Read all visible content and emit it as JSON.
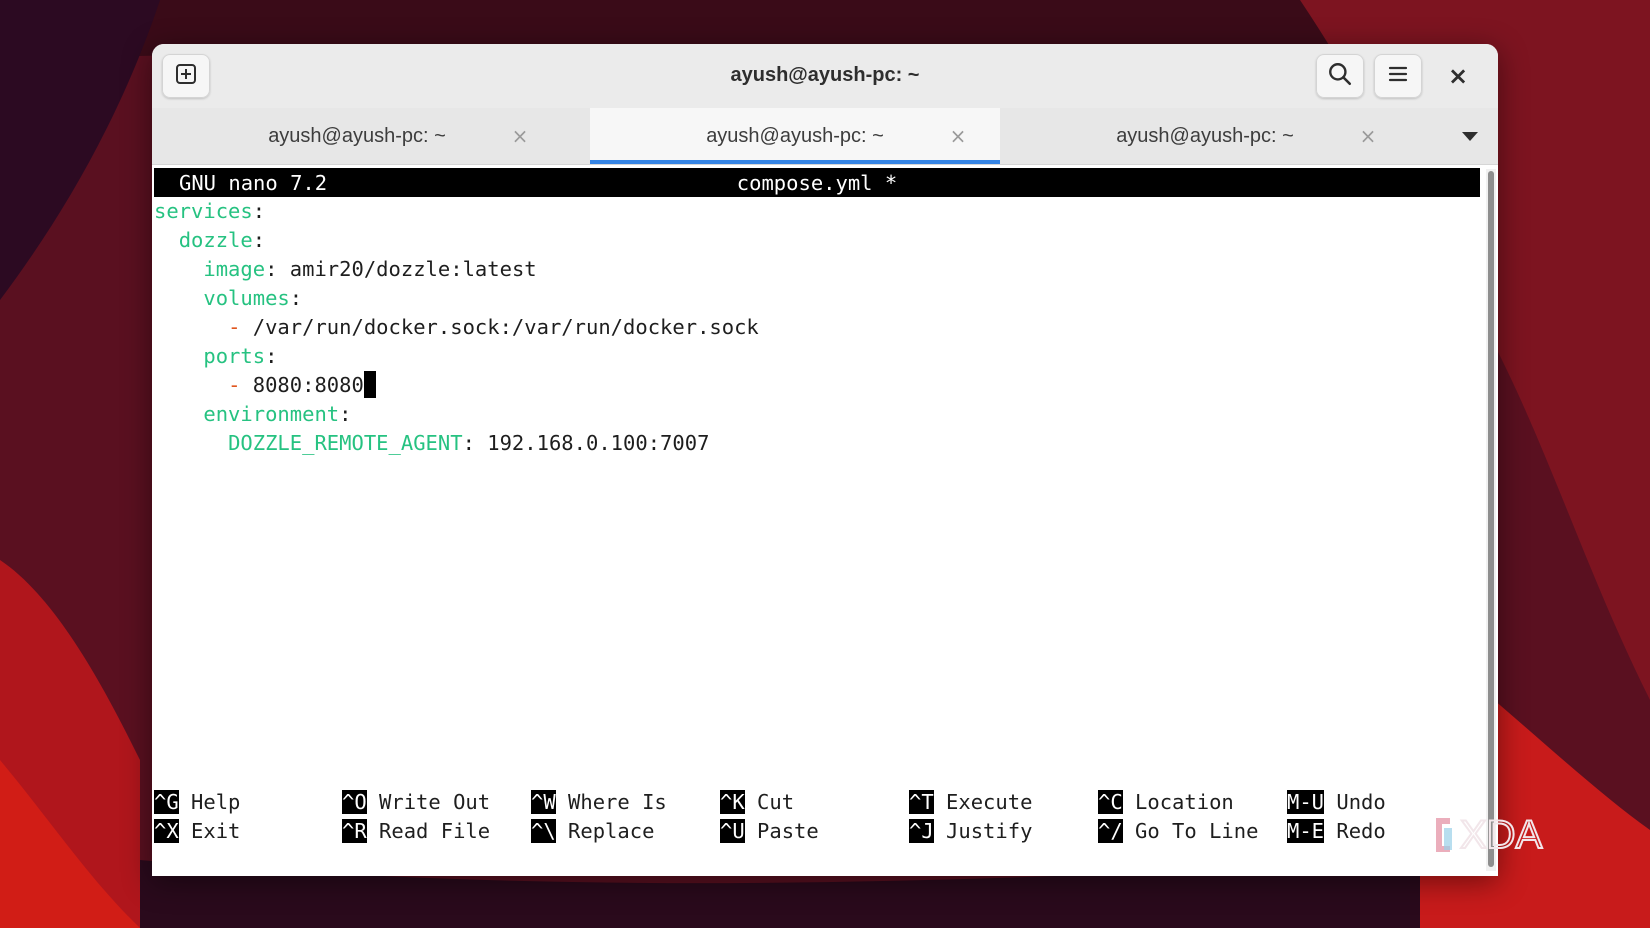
{
  "window": {
    "title": "ayush@ayush-pc: ~",
    "new_tab_icon": "new-tab-icon",
    "search_icon": "search-icon",
    "menu_icon": "hamburger-menu-icon",
    "close_icon": "close-icon",
    "close_glyph": "×"
  },
  "tabs": [
    {
      "label": "ayush@ayush-pc: ~",
      "active": false,
      "close": "×"
    },
    {
      "label": "ayush@ayush-pc: ~",
      "active": true,
      "close": "×"
    },
    {
      "label": "ayush@ayush-pc: ~",
      "active": false,
      "close": "×"
    }
  ],
  "nano": {
    "version": "GNU nano 7.2",
    "filename": "compose.yml *",
    "content": {
      "services_key": "services",
      "dozzle_key": "dozzle",
      "image_key": "image",
      "image_value": "amir20/dozzle:latest",
      "volumes_key": "volumes",
      "volume_item": "/var/run/docker.sock:/var/run/docker.sock",
      "ports_key": "ports",
      "port_item": "8080:8080",
      "environment_key": "environment",
      "env_key": "DOZZLE_REMOTE_AGENT",
      "env_value": "192.168.0.100:7007",
      "colon": ":",
      "dash": "-"
    },
    "shortcuts": [
      {
        "key": "^G",
        "label": "Help"
      },
      {
        "key": "^O",
        "label": "Write Out"
      },
      {
        "key": "^W",
        "label": "Where Is"
      },
      {
        "key": "^K",
        "label": "Cut"
      },
      {
        "key": "^T",
        "label": "Execute"
      },
      {
        "key": "^C",
        "label": "Location"
      },
      {
        "key": "M-U",
        "label": "Undo"
      },
      {
        "key": "^X",
        "label": "Exit"
      },
      {
        "key": "^R",
        "label": "Read File"
      },
      {
        "key": "^\\",
        "label": "Replace"
      },
      {
        "key": "^U",
        "label": "Paste"
      },
      {
        "key": "^J",
        "label": "Justify"
      },
      {
        "key": "^/",
        "label": "Go To Line"
      },
      {
        "key": "M-E",
        "label": "Redo"
      }
    ]
  },
  "colors": {
    "yaml_key": "#26c281",
    "list_dash": "#e0561f",
    "tab_accent": "#3584e4"
  },
  "watermark": {
    "text": "XDA"
  }
}
